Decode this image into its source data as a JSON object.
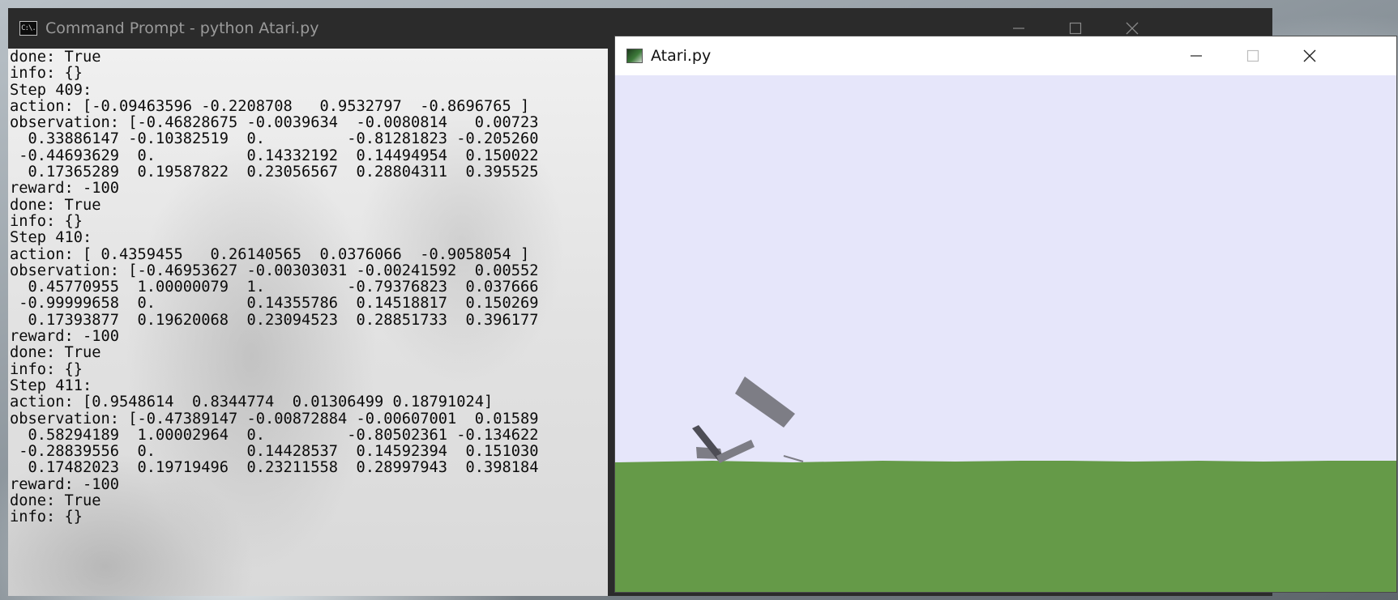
{
  "cmd_window": {
    "title": "Command Prompt - python  Atari.py",
    "icon": "cmd-icon",
    "icon_text": "C:\\.",
    "controls": {
      "minimize": "—",
      "maximize": "☐",
      "close": "✕"
    },
    "lines": [
      "done: True",
      "info: {}",
      "Step 409:",
      "action: [-0.09463596 -0.2208708   0.9532797  -0.8696765 ]",
      "observation: [-0.46828675 -0.0039634  -0.0080814   0.00723",
      "  0.33886147 -0.10382519  0.         -0.81281823 -0.205260",
      " -0.44693629  0.          0.14332192  0.14494954  0.150022",
      "  0.17365289  0.19587822  0.23056567  0.28804311  0.395525",
      "reward: -100",
      "done: True",
      "info: {}",
      "Step 410:",
      "action: [ 0.4359455   0.26140565  0.0376066  -0.9058054 ]",
      "observation: [-0.46953627 -0.00303031 -0.00241592  0.00552",
      "  0.45770955  1.00000079  1.         -0.79376823  0.037666",
      " -0.99999658  0.          0.14355786  0.14518817  0.150269",
      "  0.17393877  0.19620068  0.23094523  0.28851733  0.396177",
      "reward: -100",
      "done: True",
      "info: {}",
      "Step 411:",
      "action: [0.9548614  0.8344774  0.01306499 0.18791024]",
      "observation: [-0.47389147 -0.00872884 -0.00607001  0.01589",
      "  0.58294189  1.00002964  0.         -0.80502361 -0.134622",
      " -0.28839556  0.          0.14428537  0.14592394  0.151030",
      "  0.17482023  0.19719496  0.23211558  0.28997943  0.398184",
      "reward: -100",
      "done: True",
      "info: {}"
    ]
  },
  "atari_window": {
    "title": "Atari.py",
    "icon": "python-app-icon",
    "controls": {
      "minimize": "—",
      "maximize": "☐",
      "close": "✕"
    },
    "scene": {
      "sky_color": "#e6e6fa",
      "ground_color": "#659a48",
      "walker_color": "#7d7d85",
      "walker_dark_color": "#4d4d55"
    }
  }
}
